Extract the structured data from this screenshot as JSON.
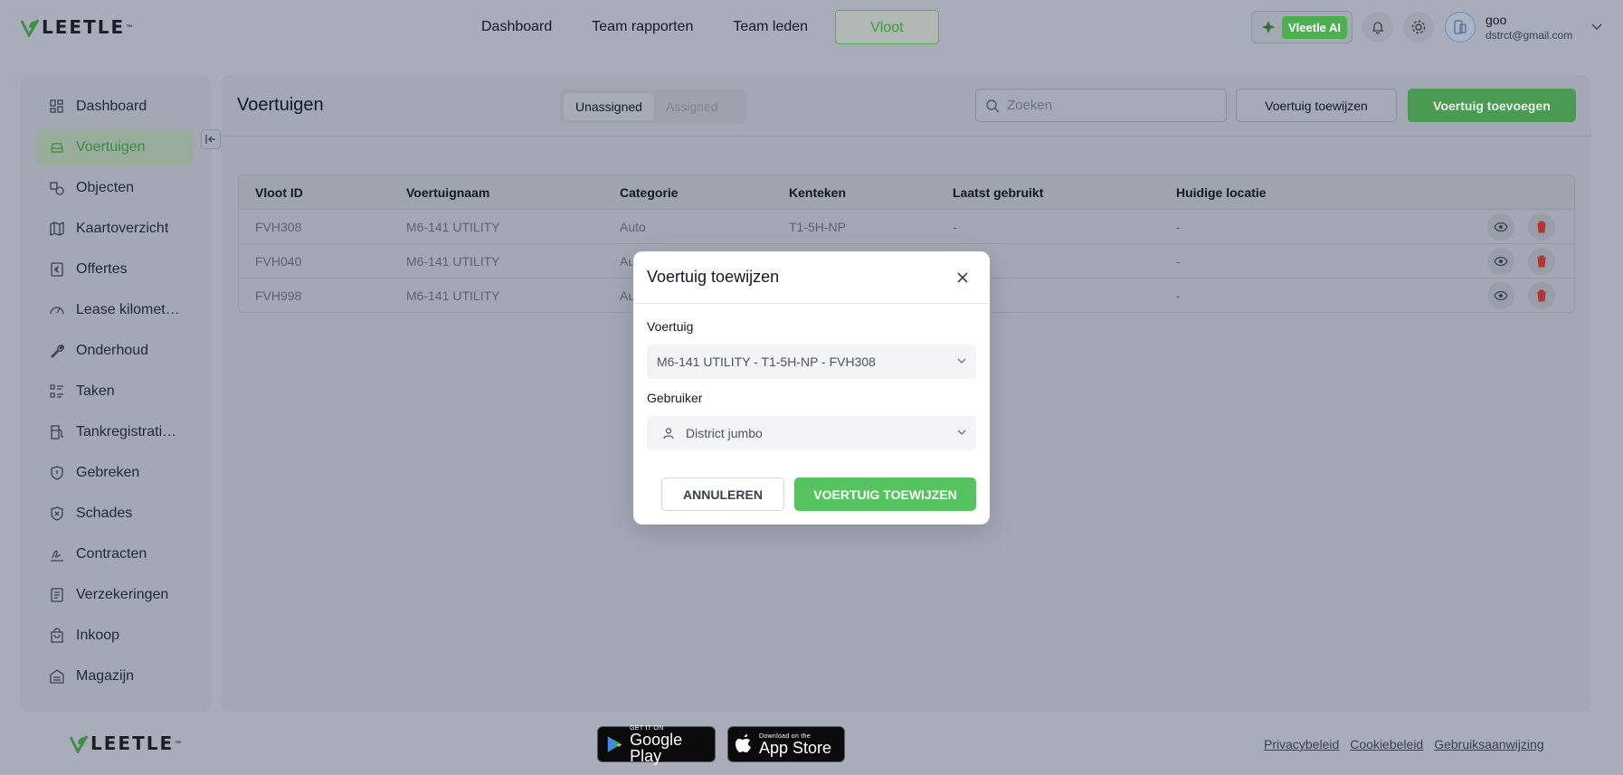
{
  "brand": {
    "name": "LEETLE",
    "tm": "™"
  },
  "nav": {
    "links": [
      "Dashboard",
      "Team rapporten",
      "Team leden"
    ],
    "active": "Vloot",
    "ai_label": "Vleetle AI"
  },
  "user": {
    "name": "goo",
    "email": "dstrct@gmail.com"
  },
  "sidebar": {
    "items": [
      {
        "label": "Dashboard",
        "icon": "grid-icon"
      },
      {
        "label": "Voertuigen",
        "icon": "car-icon"
      },
      {
        "label": "Objecten",
        "icon": "objects-icon"
      },
      {
        "label": "Kaartoverzicht",
        "icon": "map-icon"
      },
      {
        "label": "Offertes",
        "icon": "quote-icon"
      },
      {
        "label": "Lease kilomet…",
        "icon": "gauge-icon"
      },
      {
        "label": "Onderhoud",
        "icon": "wrench-icon"
      },
      {
        "label": "Taken",
        "icon": "tasks-icon"
      },
      {
        "label": "Tankregistrati…",
        "icon": "fuel-icon"
      },
      {
        "label": "Gebreken",
        "icon": "shield-alert-icon"
      },
      {
        "label": "Schades",
        "icon": "shield-x-icon"
      },
      {
        "label": "Contracten",
        "icon": "signature-icon"
      },
      {
        "label": "Verzekeringen",
        "icon": "document-icon"
      },
      {
        "label": "Inkoop",
        "icon": "bag-icon"
      },
      {
        "label": "Magazijn",
        "icon": "warehouse-icon"
      }
    ]
  },
  "page": {
    "title": "Voertuigen",
    "tabs": [
      "Unassigned",
      "Assigned"
    ],
    "search_placeholder": "Zoeken",
    "assign_button": "Voertuig toewijzen",
    "add_button": "Voertuig toevoegen"
  },
  "table": {
    "headers": [
      "Vloot ID",
      "Voertuignaam",
      "Categorie",
      "Kenteken",
      "Laatst gebruikt",
      "Huidige locatie"
    ],
    "rows": [
      [
        "FVH308",
        "M6-141 UTILITY",
        "Auto",
        "T1-5H-NP",
        "-",
        "-"
      ],
      [
        "FVH040",
        "M6-141 UTILITY",
        "Au",
        "",
        "",
        "-"
      ],
      [
        "FVH998",
        "M6-141 UTILITY",
        "Au",
        "",
        "",
        "-"
      ]
    ]
  },
  "modal": {
    "title": "Voertuig toewijzen",
    "vehicle_label": "Voertuig",
    "vehicle_value": "M6-141 UTILITY - T1-5H-NP - FVH308",
    "user_label": "Gebruiker",
    "user_value": "District jumbo",
    "cancel": "ANNULEREN",
    "confirm": "VOERTUIG TOEWIJZEN"
  },
  "footer": {
    "google_small": "GET IT ON",
    "google_big": "Google Play",
    "apple_small": "Download on the",
    "apple_big": "App Store",
    "links": [
      "Privacybeleid",
      "Cookiebeleid",
      "Gebruiksaanwijzing"
    ]
  },
  "colors": {
    "accent": "#55c35f",
    "overlay": "#a9adba"
  }
}
